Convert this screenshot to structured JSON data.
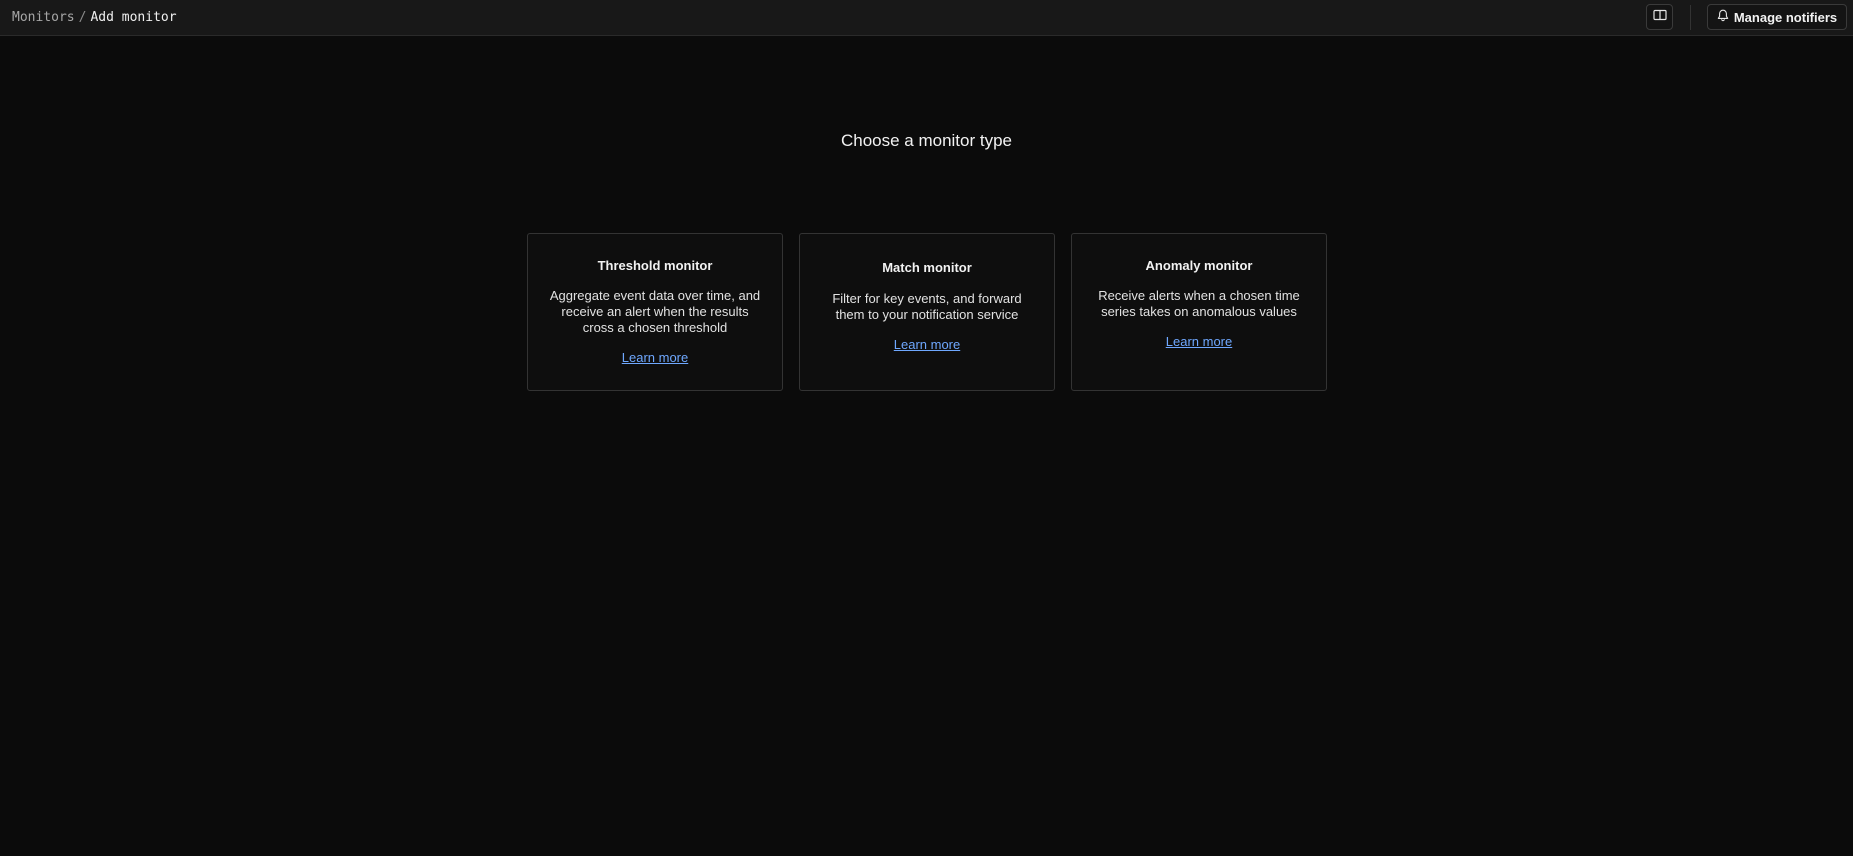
{
  "breadcrumb": {
    "parent": "Monitors",
    "separator": "/",
    "current": "Add monitor"
  },
  "toolbar": {
    "docs_icon": "book-icon",
    "notifiers_icon": "bell-icon",
    "notifiers_label": "Manage notifiers"
  },
  "main": {
    "title": "Choose a monitor type",
    "cards": [
      {
        "title": "Threshold monitor",
        "description": "Aggregate event data over time, and receive an alert when the results cross a chosen threshold",
        "link": "Learn more"
      },
      {
        "title": "Match monitor",
        "description": "Filter for key events, and forward them to your notification service",
        "link": "Learn more"
      },
      {
        "title": "Anomaly monitor",
        "description": "Receive alerts when a chosen time series takes on anomalous values",
        "link": "Learn more"
      }
    ]
  },
  "colors": {
    "background": "#0b0b0b",
    "topbar": "#181818",
    "border": "#333333",
    "link": "#6fa8ff",
    "text": "#f2f2f2"
  }
}
